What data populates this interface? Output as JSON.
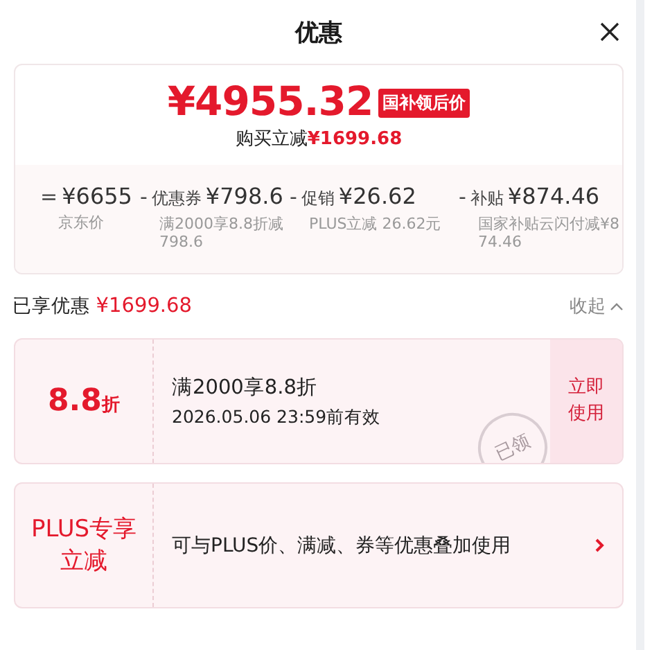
{
  "header": {
    "title": "优惠"
  },
  "summary": {
    "price": "¥4955.32",
    "badge": "国补领后价",
    "saving_label": "购买立减",
    "saving_amount": "¥1699.68",
    "breakdown": [
      {
        "op": "=",
        "amount": "¥6655",
        "note": "京东价"
      },
      {
        "op": "-",
        "label": "优惠券",
        "amount": "¥798.6",
        "note": "满2000享8.8折减798.6"
      },
      {
        "op": "-",
        "label": "促销",
        "amount": "¥26.62",
        "note": "PLUS立减 26.62元"
      },
      {
        "op": "-",
        "label": "补贴",
        "amount": "¥874.46",
        "note": "国家补贴云闪付减¥874.46"
      }
    ]
  },
  "enjoyed": {
    "label": "已享优惠",
    "amount": "¥1699.68",
    "toggle": "收起"
  },
  "coupons": [
    {
      "kind": "discount",
      "value": "8.8",
      "unit": "折",
      "title": "满2000享8.8折",
      "validity": "2026.05.06 23:59前有效",
      "stamp": "已领",
      "action": "立即使用"
    },
    {
      "kind": "plus",
      "badge": "PLUS专享立减",
      "text": "可与PLUS价、满减、券等优惠叠加使用"
    }
  ]
}
